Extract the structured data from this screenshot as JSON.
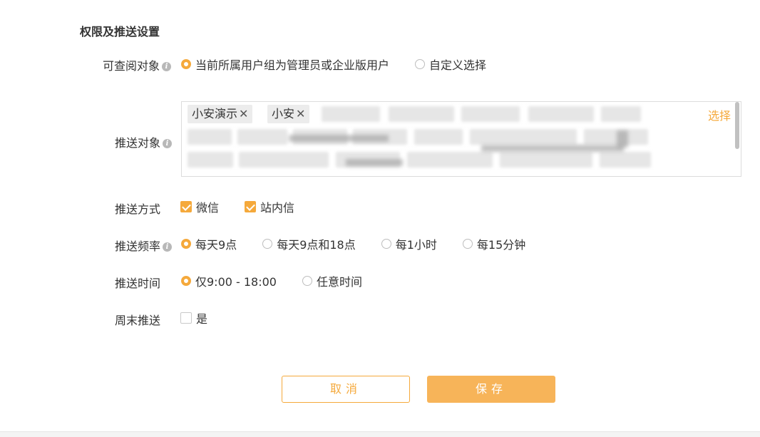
{
  "section_title": "权限及推送设置",
  "viewers": {
    "label": "可查阅对象",
    "options": [
      "当前所属用户组为管理员或企业版用户",
      "自定义选择"
    ],
    "selected": 0
  },
  "targets": {
    "label": "推送对象",
    "select_link": "选择",
    "visible_tags": [
      "小安演示",
      "小安"
    ],
    "remove_glyph": "✕"
  },
  "push_method": {
    "label": "推送方式",
    "options": [
      {
        "label": "微信",
        "checked": true
      },
      {
        "label": "站内信",
        "checked": true
      }
    ]
  },
  "frequency": {
    "label": "推送频率",
    "options": [
      "每天9点",
      "每天9点和18点",
      "每1小时",
      "每15分钟"
    ],
    "selected": 0
  },
  "push_time": {
    "label": "推送时间",
    "options": [
      "仅9:00 - 18:00",
      "任意时间"
    ],
    "selected": 0
  },
  "weekend": {
    "label": "周末推送",
    "option": "是",
    "checked": false
  },
  "buttons": {
    "cancel": "取消",
    "save": "保存"
  },
  "colors": {
    "accent": "#f5a93b",
    "save_bg": "#f7b459"
  }
}
